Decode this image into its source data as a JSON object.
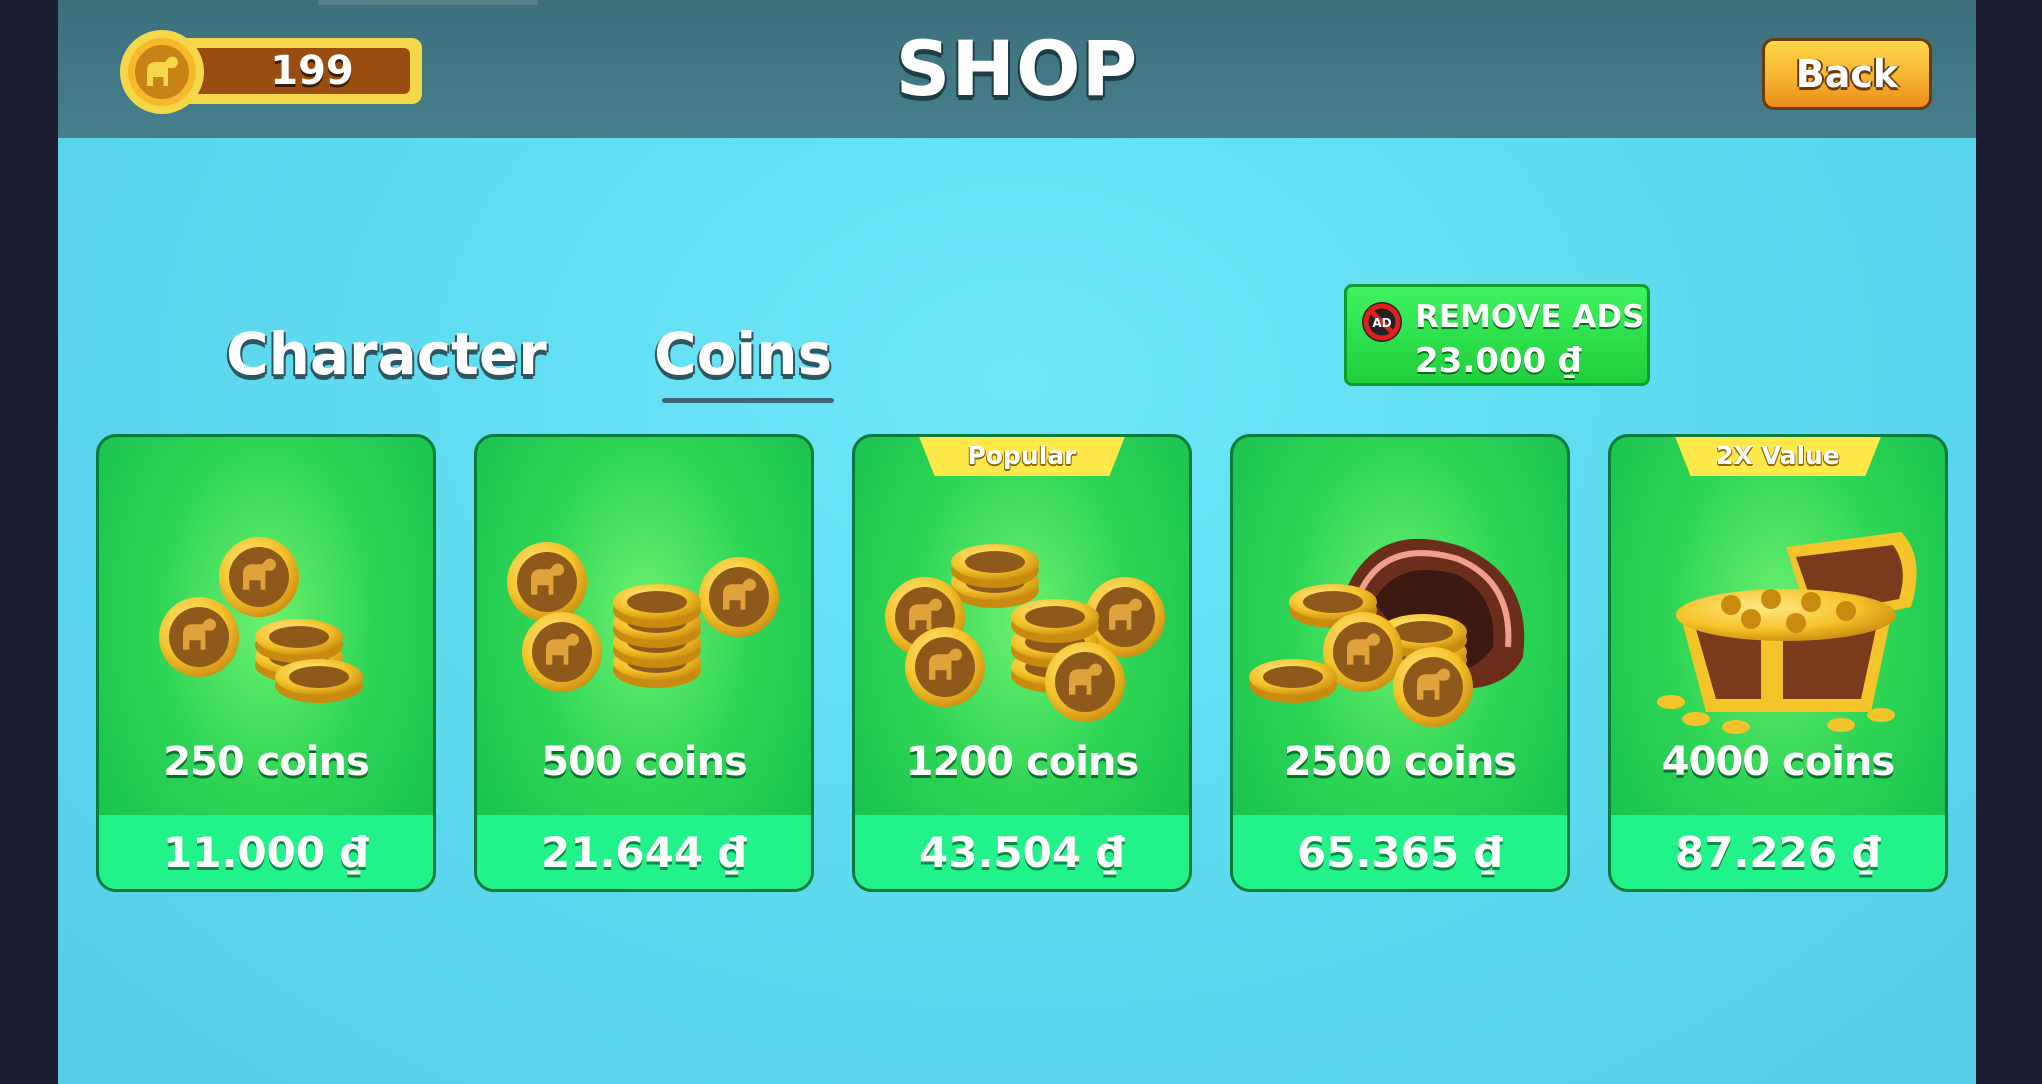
{
  "header": {
    "title": "SHOP",
    "coin_balance": "199",
    "back_label": "Back"
  },
  "tabs": [
    {
      "label": "Character",
      "active": false
    },
    {
      "label": "Coins",
      "active": true
    }
  ],
  "remove_ads": {
    "label": "REMOVE ADS",
    "price": "23.000 ₫",
    "icon": "no-ads-icon"
  },
  "packs": [
    {
      "amount": "250 coins",
      "price": "11.000 ₫",
      "badge": "",
      "art": "coin-stack-small-icon"
    },
    {
      "amount": "500 coins",
      "price": "21.644 ₫",
      "badge": "",
      "art": "coin-stack-medium-icon"
    },
    {
      "amount": "1200 coins",
      "price": "43.504 ₫",
      "badge": "Popular",
      "art": "coin-pile-icon"
    },
    {
      "amount": "2500 coins",
      "price": "65.365 ₫",
      "badge": "",
      "art": "coin-bag-icon"
    },
    {
      "amount": "4000 coins",
      "price": "87.226 ₫",
      "badge": "2X Value",
      "art": "treasure-chest-icon"
    }
  ],
  "colors": {
    "topbar": "#3d6f7d",
    "background": "#5fdcf0",
    "card_green": "#2fd556",
    "price_strip": "#22f28a",
    "ribbon": "#ffe94a",
    "coin_gold": "#f5c32a",
    "coin_brown": "#8e5a1c"
  }
}
